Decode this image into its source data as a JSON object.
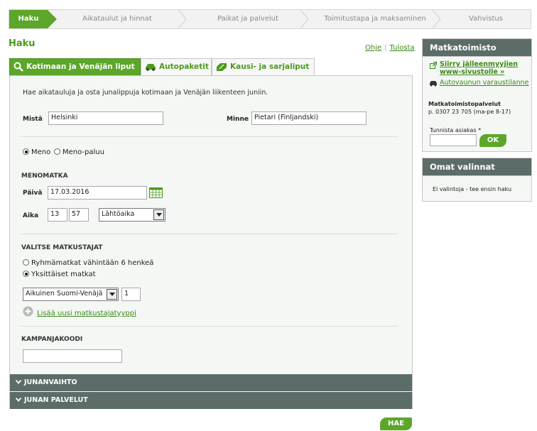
{
  "steps": [
    "Haku",
    "Aikataulut ja hinnat",
    "Paikat ja palvelut",
    "Toimitustapa ja maksaminen",
    "Vahvistus"
  ],
  "page_title": "Haku",
  "toplinks": {
    "help": "Ohje",
    "print": "Tulosta"
  },
  "tabs": [
    {
      "label": "Kotimaan ja Venäjän liput",
      "icon": "train-icon"
    },
    {
      "label": "Autopaketit",
      "icon": "car-icon"
    },
    {
      "label": "Kausi- ja sarjaliput",
      "icon": "ticket-icon"
    }
  ],
  "intro": "Hae aikatauluja ja osta junalippuja kotimaan ja Venäjän liikenteen juniin.",
  "from": {
    "label": "Mistä",
    "value": "Helsinki"
  },
  "to": {
    "label": "Minne",
    "value": "Pietari (Finljandski)"
  },
  "trip_type": {
    "one_way": "Meno",
    "return": "Meno-paluu",
    "selected": "one_way"
  },
  "outbound": {
    "heading": "MENOMATKA",
    "date_label": "Päivä",
    "date": "17.03.2016",
    "time_label": "Aika",
    "hour": "13",
    "minute": "57",
    "time_mode": "Lähtöaika"
  },
  "travellers": {
    "heading": "VALITSE MATKUSTAJAT",
    "group": "Ryhmämatkat vähintään 6 henkeä",
    "individual": "Yksittäiset matkat",
    "selected": "individual",
    "type": "Aikuinen Suomi-Venäjä",
    "count": "1",
    "add_link": "Lisää uusi matkustajatyyppi"
  },
  "campaign": {
    "heading": "KAMPANJAKOODI",
    "value": ""
  },
  "sections": {
    "change": "JUNANVAIHTO",
    "services": "JUNAN PALVELUT"
  },
  "search_button": "HAE",
  "agency": {
    "title": "Matkatoimisto",
    "reseller_link_1": "Siirry jälleenmyyjien",
    "reseller_link_2": "www-sivustolle »",
    "car_link": "Autovaunun varaustilanne",
    "services_title": "Matkatoimistopalvelut",
    "services_phone": "p. 0307 23 705 (ma-pe 8-17)",
    "identify_label": "Tunnista asiakas *",
    "ok_button": "OK"
  },
  "my_choices": {
    "title": "Omat valinnat",
    "empty": "Ei valintoja - tee ensin haku"
  },
  "colors": {
    "accent": "#5ca629",
    "dark_bar": "#5c6c68",
    "link": "#3a8a16"
  }
}
